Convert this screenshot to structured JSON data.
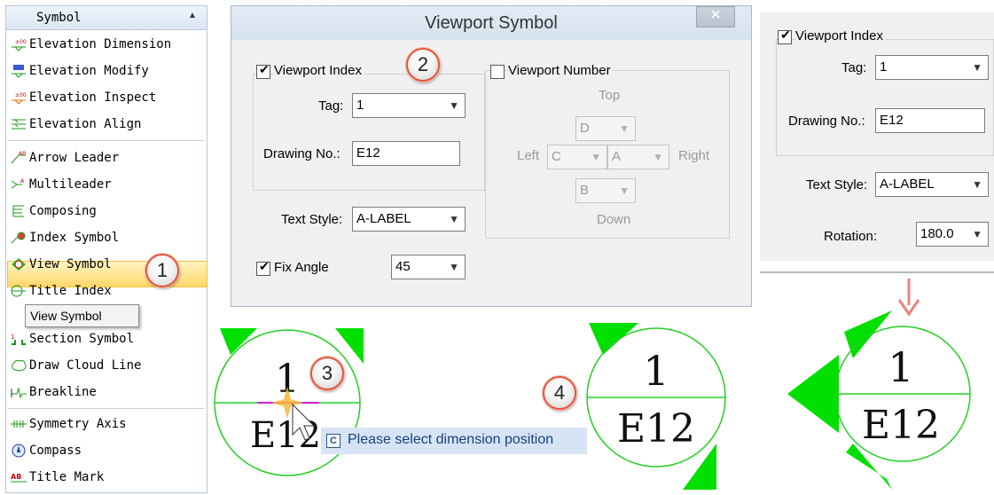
{
  "menu": {
    "title": "Symbol",
    "tooltip": "View Symbol",
    "items": [
      {
        "label": "Elevation Dimension",
        "icon": "elevation-dimension-icon"
      },
      {
        "label": "Elevation Modify",
        "icon": "elevation-modify-icon"
      },
      {
        "label": "Elevation Inspect",
        "icon": "elevation-inspect-icon"
      },
      {
        "label": "Elevation Align",
        "icon": "elevation-align-icon"
      },
      {
        "label": "Arrow Leader",
        "icon": "arrow-leader-icon"
      },
      {
        "label": "Multileader",
        "icon": "multileader-icon"
      },
      {
        "label": "Composing",
        "icon": "composing-icon"
      },
      {
        "label": "Index Symbol",
        "icon": "index-symbol-icon"
      },
      {
        "label": "View Symbol",
        "icon": "view-symbol-icon"
      },
      {
        "label": "Title Index",
        "icon": "title-index-icon"
      },
      {
        "label": "Section Symbol",
        "icon": "section-symbol-icon"
      },
      {
        "label": "Draw Cloud Line",
        "icon": "cloud-line-icon"
      },
      {
        "label": "Breakline",
        "icon": "breakline-icon"
      },
      {
        "label": "Symmetry Axis",
        "icon": "symmetry-axis-icon"
      },
      {
        "label": "Compass",
        "icon": "compass-icon"
      },
      {
        "label": "Title Mark",
        "icon": "title-mark-icon"
      }
    ]
  },
  "steps": [
    "1",
    "2",
    "3",
    "4"
  ],
  "dialog": {
    "title": "Viewport Symbol",
    "close": "✕",
    "viewport_index": "Viewport Index",
    "tag_label": "Tag:",
    "tag_value": "1",
    "drawing_no_label": "Drawing No.:",
    "drawing_no_value": "E12",
    "text_style_label": "Text Style:",
    "text_style_value": "A-LABEL",
    "fix_angle_label": "Fix Angle",
    "fix_angle_value": "45",
    "viewport_number": "Viewport Number",
    "top": "Top",
    "left": "Left",
    "right": "Right",
    "down": "Down",
    "d": "D",
    "c": "C",
    "a": "A",
    "b": "B"
  },
  "right_panel": {
    "viewport_index": "Viewport Index",
    "tag_label": "Tag:",
    "tag_value": "1",
    "drawing_no_label": "Drawing No.:",
    "drawing_no_value": "E12",
    "text_style_label": "Text Style:",
    "text_style_value": "A-LABEL",
    "rotation_label": "Rotation:",
    "rotation_value": "180.0"
  },
  "symbols": {
    "top": "1",
    "bottom": "E12"
  },
  "prompt": {
    "icon": "C",
    "text": "Please select dimension position"
  },
  "colors": {
    "symbol_green": "#00e000",
    "arrow_red": "#f08080",
    "highlight": "#ffd86b",
    "badge_ring": "#e4573f"
  }
}
